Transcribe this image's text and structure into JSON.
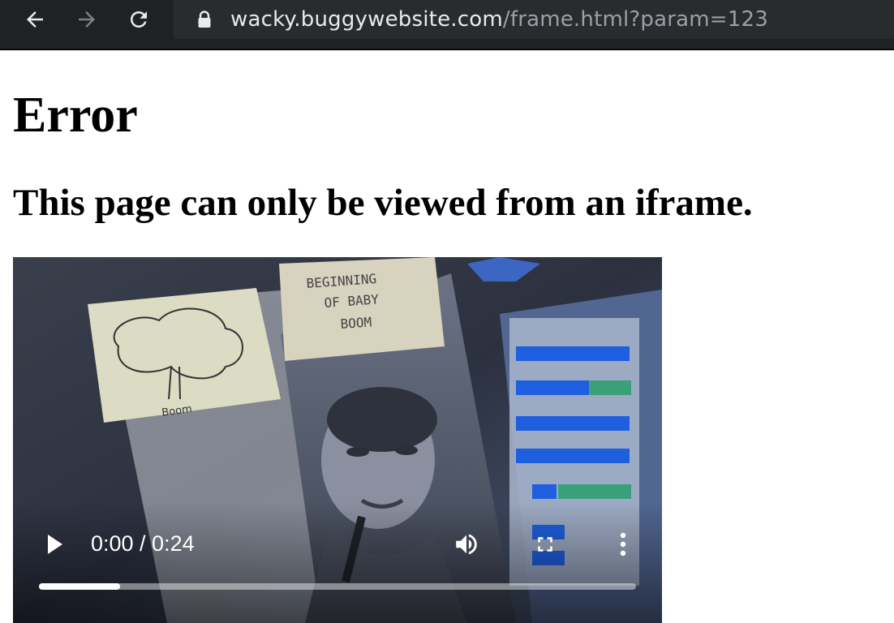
{
  "browser": {
    "url_host": "wacky.buggywebsite.com",
    "url_path": "/frame.html?param=123",
    "icons": {
      "back": "back-arrow-icon",
      "forward": "forward-arrow-icon",
      "reload": "reload-icon",
      "lock": "lock-icon"
    },
    "colors": {
      "toolbar_bg": "#202124",
      "host_text": "#e8eaed",
      "path_text": "#9aa0a6"
    }
  },
  "page": {
    "title": "Error",
    "subtitle": "This page can only be viewed from an iframe."
  },
  "video": {
    "current_time": "0:00",
    "duration": "0:24",
    "time_display": "0:00 / 0:24",
    "progress_fraction": 0.136,
    "frame_text": [
      "BEGINNING",
      "OF BABY",
      "BOOM",
      "Boom"
    ],
    "icons": {
      "play": "play-icon",
      "volume": "volume-icon",
      "fullscreen": "fullscreen-icon",
      "more": "more-options-icon"
    }
  }
}
